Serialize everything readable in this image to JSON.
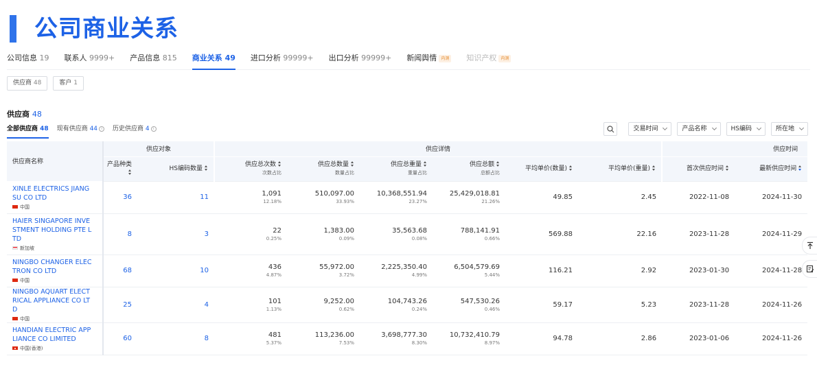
{
  "page_title": "公司商业关系",
  "tabs": [
    {
      "label": "公司信息",
      "count": "19"
    },
    {
      "label": "联系人",
      "count": "9999+"
    },
    {
      "label": "产品信息",
      "count": "815"
    },
    {
      "label": "商业关系",
      "count": "49"
    },
    {
      "label": "进口分析",
      "count": "99999+"
    },
    {
      "label": "出口分析",
      "count": "99999+"
    },
    {
      "label": "新闻舆情",
      "count": "",
      "badge": "内测"
    },
    {
      "label": "知识产权",
      "count": "",
      "badge": "内测"
    }
  ],
  "subtabs": [
    {
      "label": "供应商",
      "count": "48"
    },
    {
      "label": "客户",
      "count": "1"
    }
  ],
  "section": {
    "title": "供应商",
    "count": "48"
  },
  "filter_tabs": [
    {
      "label": "全部供应商",
      "count": "48"
    },
    {
      "label": "现有供应商",
      "count": "44"
    },
    {
      "label": "历史供应商",
      "count": "4"
    }
  ],
  "info_icon_glyph": "i",
  "toolbar": {
    "search_icon": "search-icon",
    "dropdowns": [
      "交易时间",
      "产品名称",
      "HS编码",
      "所在地"
    ]
  },
  "table": {
    "group_headers": {
      "supplier_name": "供应商名称",
      "supply_object": "供应对象",
      "supply_detail": "供应详情",
      "supply_time": "供应时间"
    },
    "columns": {
      "product_types": "产品种类",
      "hs_count": "HS编码数量",
      "total_times": "供应总次数",
      "total_times_sub": "次数占比",
      "total_qty": "供应总数量",
      "total_qty_sub": "数量占比",
      "total_weight": "供应总重量",
      "total_weight_sub": "重量占比",
      "total_amount": "供应总额",
      "total_amount_sub": "总额占比",
      "unit_price_qty": "平均单价(数量)",
      "unit_price_weight": "平均单价(重量)",
      "first_date": "首次供应时间",
      "last_date": "最新供应时间"
    },
    "rows": [
      {
        "name": "XINLE ELECTRICS JIANGSU CO LTD",
        "country": "中国",
        "flag": "cn",
        "product_types": "36",
        "hs_count": "11",
        "times": "1,091",
        "times_pct": "12.18%",
        "qty": "510,097.00",
        "qty_pct": "33.93%",
        "weight": "10,368,551.94",
        "weight_pct": "23.27%",
        "amount": "25,429,018.81",
        "amount_pct": "21.26%",
        "unit_qty": "49.85",
        "unit_weight": "2.45",
        "first": "2022-11-08",
        "last": "2024-11-30"
      },
      {
        "name": "HAIER SINGAPORE INVESTMENT HOLDING PTE LTD",
        "country": "新加坡",
        "flag": "sg",
        "product_types": "8",
        "hs_count": "3",
        "times": "22",
        "times_pct": "0.25%",
        "qty": "1,383.00",
        "qty_pct": "0.09%",
        "weight": "35,563.68",
        "weight_pct": "0.08%",
        "amount": "788,141.91",
        "amount_pct": "0.66%",
        "unit_qty": "569.88",
        "unit_weight": "22.16",
        "first": "2023-11-28",
        "last": "2024-11-29"
      },
      {
        "name": "NINGBO CHANGER ELECTRON CO LTD",
        "country": "中国",
        "flag": "cn",
        "product_types": "68",
        "hs_count": "10",
        "times": "436",
        "times_pct": "4.87%",
        "qty": "55,972.00",
        "qty_pct": "3.72%",
        "weight": "2,225,350.40",
        "weight_pct": "4.99%",
        "amount": "6,504,579.69",
        "amount_pct": "5.44%",
        "unit_qty": "116.21",
        "unit_weight": "2.92",
        "first": "2023-01-30",
        "last": "2024-11-28"
      },
      {
        "name": "NINGBO AQUART ELECTRICAL APPLIANCE CO LTD",
        "country": "中国",
        "flag": "cn",
        "product_types": "25",
        "hs_count": "4",
        "times": "101",
        "times_pct": "1.13%",
        "qty": "9,252.00",
        "qty_pct": "0.62%",
        "weight": "104,743.26",
        "weight_pct": "0.24%",
        "amount": "547,530.26",
        "amount_pct": "0.46%",
        "unit_qty": "59.17",
        "unit_weight": "5.23",
        "first": "2023-11-28",
        "last": "2024-11-26"
      },
      {
        "name": "HANDIAN ELECTRIC APPLIANCE CO LIMITED",
        "country": "中国(香港)",
        "flag": "hk",
        "product_types": "60",
        "hs_count": "8",
        "times": "481",
        "times_pct": "5.37%",
        "qty": "113,236.00",
        "qty_pct": "7.53%",
        "weight": "3,698,777.30",
        "weight_pct": "8.30%",
        "amount": "10,732,410.79",
        "amount_pct": "8.97%",
        "unit_qty": "94.78",
        "unit_weight": "2.86",
        "first": "2023-01-06",
        "last": "2024-11-26"
      }
    ]
  },
  "side_buttons": [
    "back-to-top-icon",
    "feedback-icon"
  ],
  "colors": {
    "accent": "#1d62e6",
    "beta_badge": "#e58a2c"
  }
}
